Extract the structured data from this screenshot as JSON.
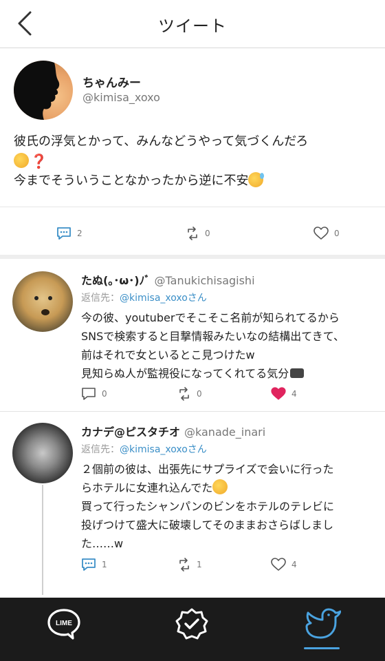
{
  "header": {
    "title": "ツイート"
  },
  "main_tweet": {
    "name": "ちゃんみー",
    "handle": "@kimisa_xoxo",
    "text_line1": "彼氏の浮気とかって、みんなどうやって気づくんだろ",
    "text_line3": "今までそういうことなかったから逆に不安",
    "emoji_q": "❓",
    "reply_count": "2",
    "retweet_count": "0",
    "like_count": "0"
  },
  "replies": [
    {
      "name": "たぬ(｡･ω･)ﾉﾞ",
      "handle": "@Tanukichisagishi",
      "replyto_prefix": "返信先：",
      "replyto_handle": "@kimisa_xoxoさん",
      "lines": [
        "今の彼、youtuberでそこそこ名前が知られてるから",
        "SNSで検索すると目撃情報みたいなの結構出てきて、",
        "前はそれで女といるとこ見つけたw",
        "見知らぬ人が監視役になってくれてる気分"
      ],
      "reply_count": "0",
      "retweet_count": "0",
      "like_count": "4"
    },
    {
      "name": "カナデ@ピスタチオ",
      "handle": "@kanade_inari",
      "replyto_prefix": "返信先：",
      "replyto_handle": "@kimisa_xoxoさん",
      "lines": [
        "２個前の彼は、出張先にサプライズで会いに行った",
        "らホテルに女連れ込んでた",
        "買って行ったシャンパンのビンをホテルのテレビに",
        "投げつけて盛大に破壊してそのままおさらばしまし",
        "た……w"
      ],
      "reply_count": "1",
      "retweet_count": "1",
      "like_count": "4"
    }
  ],
  "nav": {
    "lime_label": "LIME"
  },
  "colors": {
    "accent": "#3b8fc7",
    "like_active": "#e0245e",
    "nav_bg": "#1b1b1b"
  }
}
